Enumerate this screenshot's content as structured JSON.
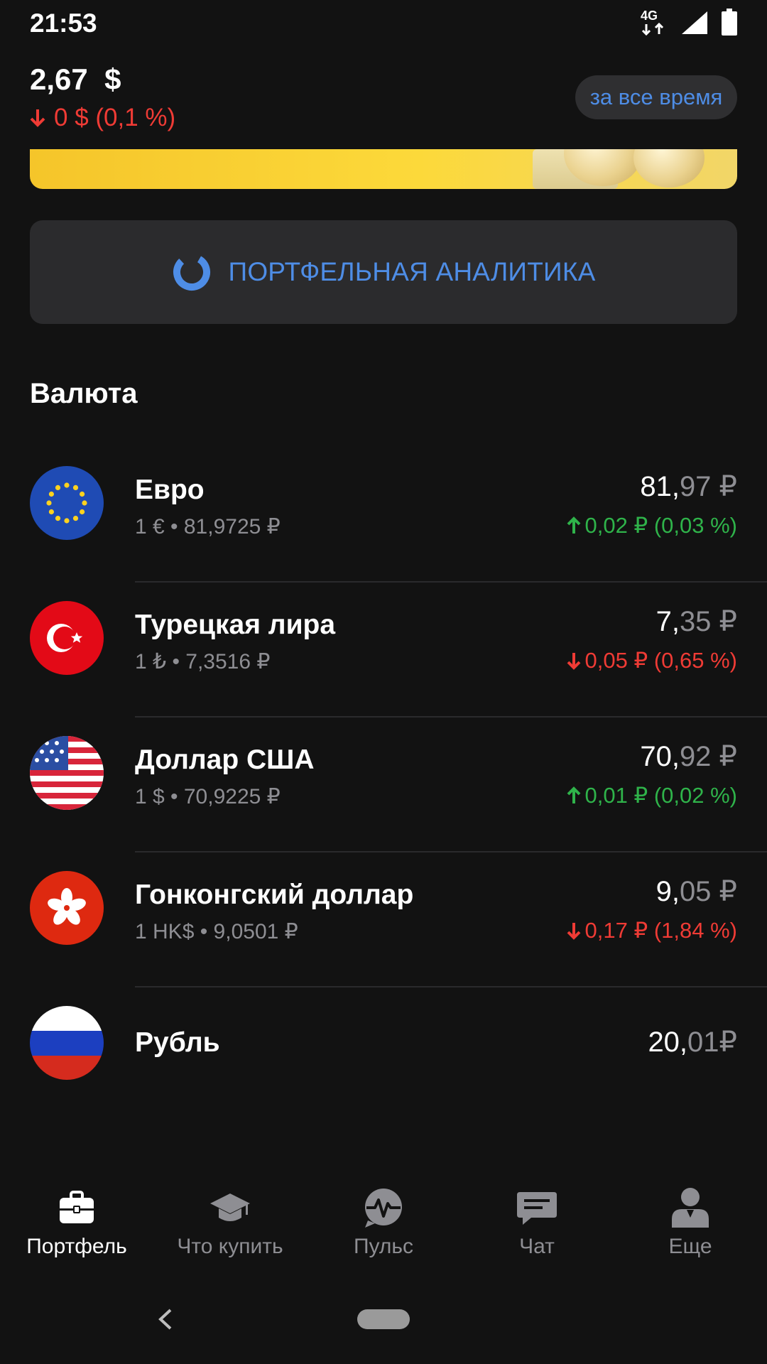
{
  "status_bar": {
    "time": "21:53",
    "network": "4G"
  },
  "header": {
    "amount": "2,67  $",
    "change": "0 $ (0,1 %)",
    "period_button": "за все время"
  },
  "analytics_button": {
    "label": "ПОРТФЕЛЬНАЯ АНАЛИТИКА"
  },
  "section": {
    "title": "Валюта"
  },
  "currencies": [
    {
      "name": "Евро",
      "rate": "1 € • 81,9725 ₽",
      "price_int": "81,",
      "price_frac": "97",
      "price_currency": " ₽",
      "change": "0,02 ₽ (0,03 %)",
      "direction": "up",
      "flag": "eu-flag-icon"
    },
    {
      "name": "Турецкая лира",
      "rate": "1 ₺ • 7,3516 ₽",
      "price_int": "7,",
      "price_frac": "35",
      "price_currency": " ₽",
      "change": "0,05 ₽ (0,65 %)",
      "direction": "down",
      "flag": "turkey-flag-icon"
    },
    {
      "name": "Доллар США",
      "rate": "1 $ • 70,9225 ₽",
      "price_int": "70,",
      "price_frac": "92",
      "price_currency": " ₽",
      "change": "0,01 ₽ (0,02 %)",
      "direction": "up",
      "flag": "usa-flag-icon"
    },
    {
      "name": "Гонконгский доллар",
      "rate": "1 HK$ • 9,0501 ₽",
      "price_int": "9,",
      "price_frac": "05",
      "price_currency": " ₽",
      "change": "0,17 ₽ (1,84 %)",
      "direction": "down",
      "flag": "hong-kong-flag-icon"
    },
    {
      "name": "Рубль",
      "price_int": "20,",
      "price_frac": "01",
      "price_currency": "₽",
      "flag": "russia-flag-icon"
    }
  ],
  "bottom_nav": [
    {
      "label": "Портфель",
      "icon": "briefcase-icon",
      "active": true
    },
    {
      "label": "Что купить",
      "icon": "graduation-cap-icon",
      "active": false
    },
    {
      "label": "Пульс",
      "icon": "pulse-icon",
      "active": false
    },
    {
      "label": "Чат",
      "icon": "chat-icon",
      "active": false
    },
    {
      "label": "Еще",
      "icon": "person-icon",
      "active": false
    }
  ],
  "colors": {
    "accent": "#4e8de6",
    "up": "#2fb34a",
    "down": "#ef3b35",
    "background": "#121212",
    "muted": "#8e8e93"
  }
}
